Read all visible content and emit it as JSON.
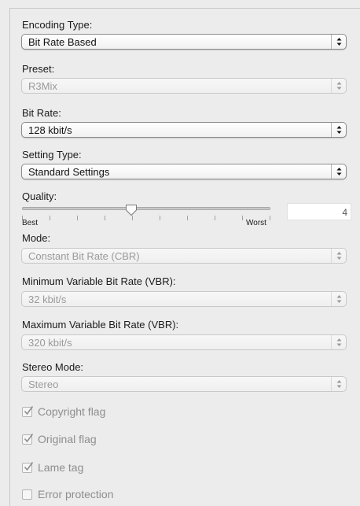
{
  "encoding": {
    "label": "Encoding Type:",
    "value": "Bit Rate Based"
  },
  "preset": {
    "label": "Preset:",
    "value": "R3Mix"
  },
  "bitrate": {
    "label": "Bit Rate:",
    "value": "128 kbit/s"
  },
  "setting": {
    "label": "Setting Type:",
    "value": "Standard Settings"
  },
  "quality": {
    "label": "Quality:",
    "best": "Best",
    "worst": "Worst",
    "value": "4",
    "slider_fraction": 0.44
  },
  "mode": {
    "label": "Mode:",
    "value": "Constant Bit Rate (CBR)"
  },
  "min_vbr": {
    "label": "Minimum Variable Bit Rate (VBR):",
    "value": "32 kbit/s"
  },
  "max_vbr": {
    "label": "Maximum Variable Bit Rate (VBR):",
    "value": "320 kbit/s"
  },
  "stereo": {
    "label": "Stereo Mode:",
    "value": "Stereo"
  },
  "checks": [
    {
      "label": "Copyright flag",
      "checked": true
    },
    {
      "label": "Original flag",
      "checked": true
    },
    {
      "label": "Lame tag",
      "checked": true
    },
    {
      "label": "Error protection",
      "checked": false
    }
  ]
}
